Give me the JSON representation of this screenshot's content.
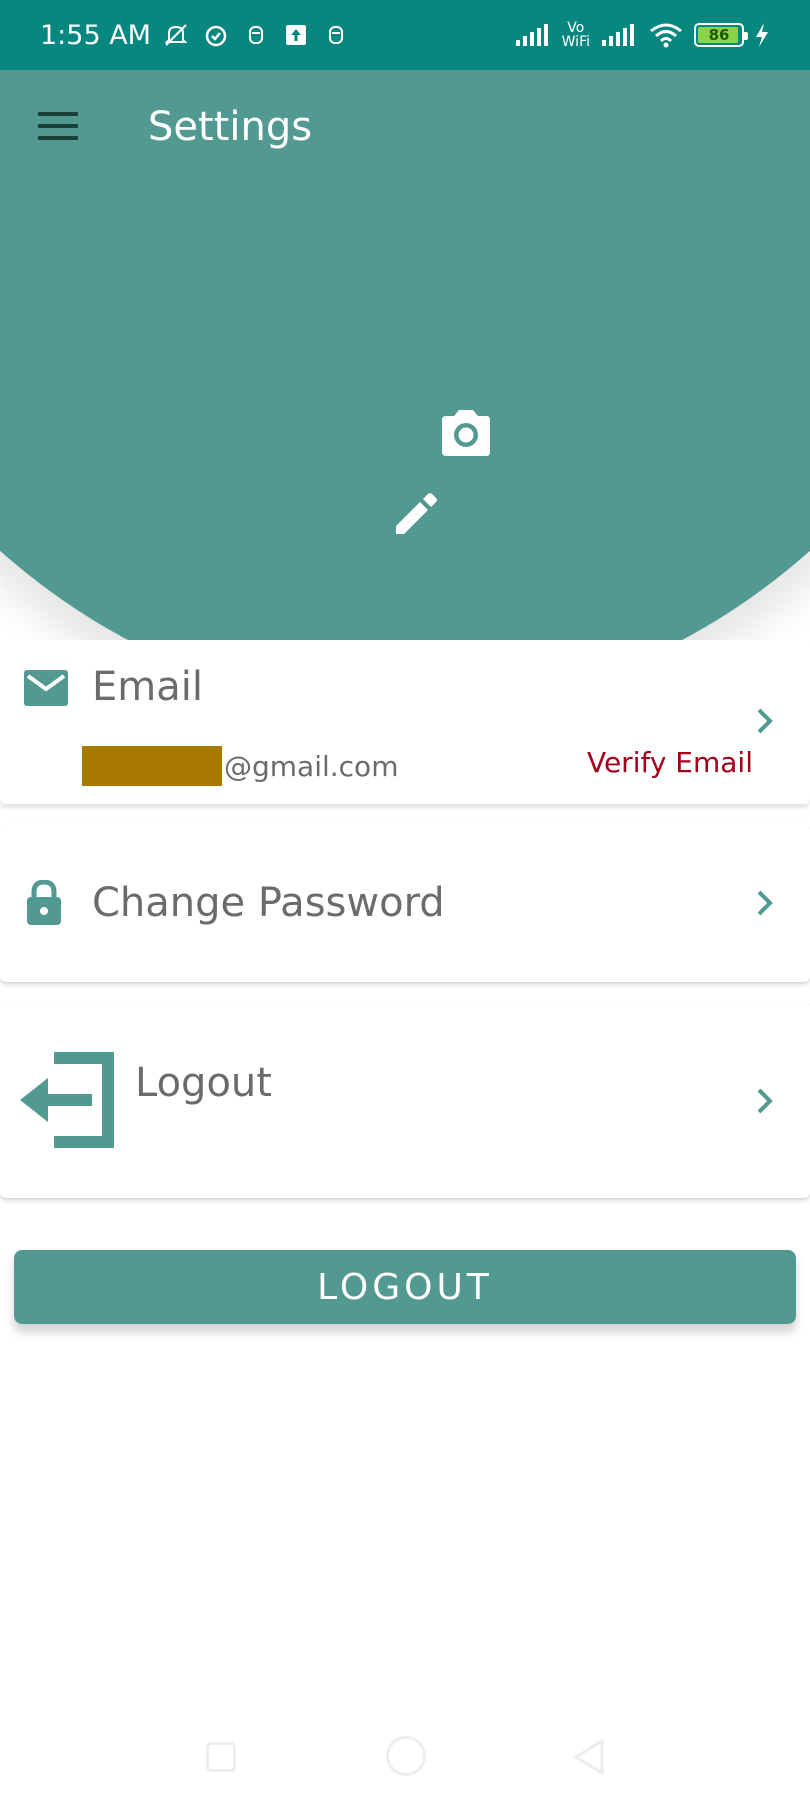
{
  "status_bar": {
    "time": "1:55 AM",
    "volte_top": "Vo",
    "volte_bottom": "WiFi",
    "battery_level": "86",
    "icons": [
      "mute-icon",
      "alarm-icon",
      "notification-icon",
      "upload-icon",
      "notification-icon",
      "signal-icon",
      "signal-icon",
      "wifi-icon",
      "battery-icon",
      "charging-icon"
    ]
  },
  "header": {
    "title": "Settings",
    "menu_icon": "hamburger-menu-icon",
    "camera_icon": "camera-icon",
    "edit_icon": "pencil-icon",
    "background_color": "#529991",
    "status_color": "#07877f"
  },
  "email_row": {
    "label": "Email",
    "value_suffix": "@gmail.com",
    "verify_label": "Verify Email",
    "verify_color": "#a4001c"
  },
  "password_row": {
    "label": "Change Password"
  },
  "logout_row": {
    "label": "Logout"
  },
  "logout_button": {
    "label": "LOGOUT"
  }
}
